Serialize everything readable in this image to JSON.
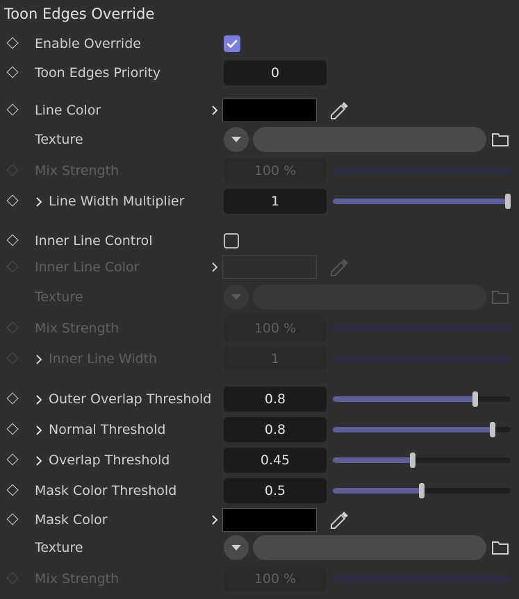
{
  "panel": {
    "title": "Toon Edges Override"
  },
  "rows": {
    "enable_override": {
      "label": "Enable Override",
      "checked": true
    },
    "priority": {
      "label": "Toon Edges Priority",
      "value": "0"
    },
    "line_color": {
      "label": "Line Color",
      "color": "#000000"
    },
    "texture1": {
      "label": "Texture"
    },
    "mix1": {
      "label": "Mix Strength",
      "value": "100 %",
      "level": 1.0
    },
    "line_width": {
      "label": "Line Width Multiplier",
      "value": "1",
      "level": 1.0
    },
    "inner_line_control": {
      "label": "Inner Line Control",
      "checked": false
    },
    "inner_line_color": {
      "label": "Inner Line Color"
    },
    "texture2": {
      "label": "Texture"
    },
    "mix2": {
      "label": "Mix Strength",
      "value": "100 %",
      "level": 1.0
    },
    "inner_line_width": {
      "label": "Inner Line Width",
      "value": "1",
      "level": 1.0
    },
    "outer_overlap": {
      "label": "Outer Overlap Threshold",
      "value": "0.8",
      "level": 0.8
    },
    "normal_threshold": {
      "label": "Normal Threshold",
      "value": "0.8",
      "level": 0.9
    },
    "overlap_threshold": {
      "label": "Overlap Threshold",
      "value": "0.45",
      "level": 0.45
    },
    "mask_color_threshold": {
      "label": "Mask Color Threshold",
      "value": "0.5",
      "level": 0.5
    },
    "mask_color": {
      "label": "Mask Color",
      "color": "#000000"
    },
    "texture3": {
      "label": "Texture"
    },
    "mix3": {
      "label": "Mix Strength",
      "value": "100 %",
      "level": 1.0
    }
  },
  "colors": {
    "accent": "#7b7ce0",
    "slider_fill": "#5d5e9a",
    "background": "#2f2f2f"
  }
}
